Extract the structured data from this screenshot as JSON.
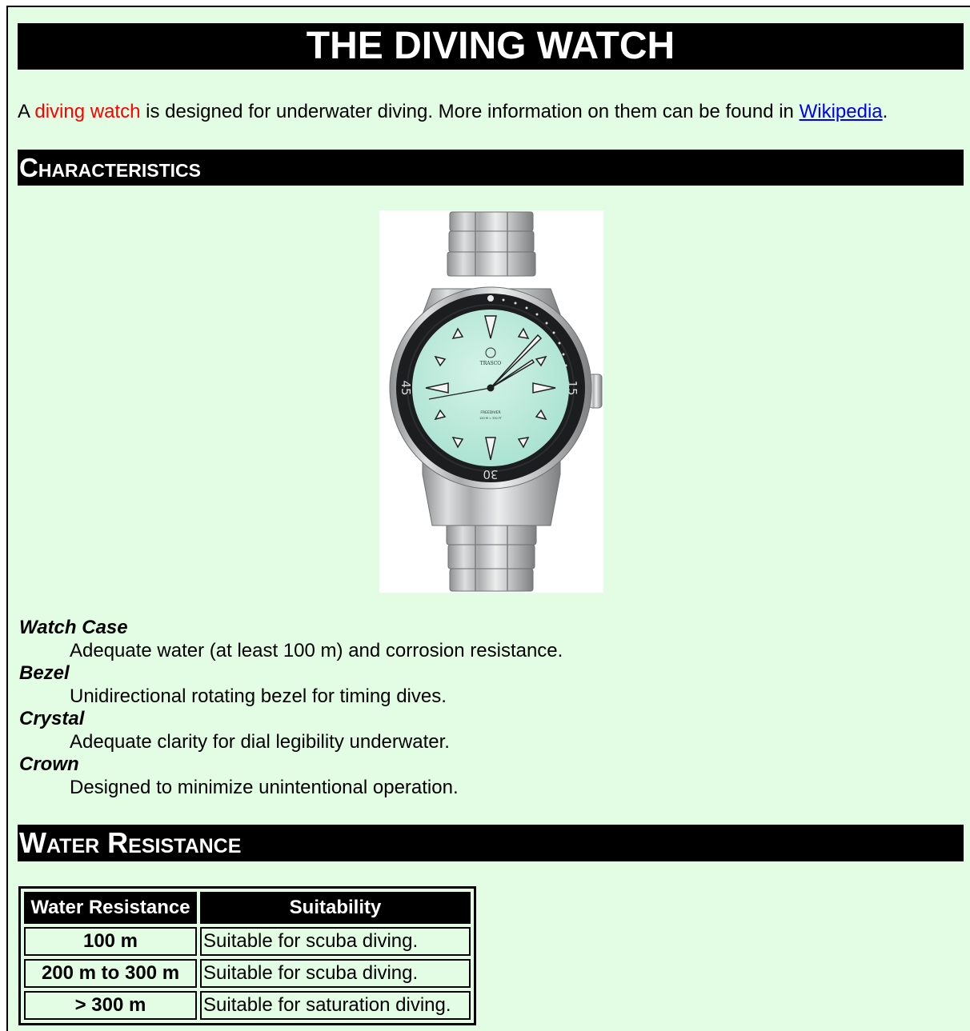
{
  "page": {
    "title": "THE DIVING WATCH",
    "intro": {
      "prefix": "A ",
      "highlight": "diving watch",
      "middle": " is designed for underwater diving. More information on them can be found in ",
      "link": "Wikipedia",
      "suffix": "."
    },
    "sections": {
      "characteristics": "Characteristics",
      "water_resistance": "Water Resistance"
    },
    "watch_image": {
      "bezel_labels": [
        "15",
        "30",
        "45"
      ],
      "brand": "TRASCO",
      "model": "FREEDIVER",
      "depth_text": "120 M = 330 FT"
    },
    "characteristics": [
      {
        "term": "Watch Case",
        "desc": "Adequate water (at least 100 m) and corrosion resistance."
      },
      {
        "term": "Bezel",
        "desc": "Unidirectional rotating bezel for timing dives."
      },
      {
        "term": "Crystal",
        "desc": "Adequate clarity for dial legibility underwater."
      },
      {
        "term": "Crown",
        "desc": "Designed to minimize unintentional operation."
      }
    ],
    "table": {
      "headers": [
        "Water Resistance",
        "Suitability"
      ],
      "rows": [
        {
          "resistance": "100 m",
          "suitability": "Suitable for scuba diving."
        },
        {
          "resistance": "200 m to 300 m",
          "suitability": "Suitable for scuba diving."
        },
        {
          "resistance": "> 300 m",
          "suitability": "Suitable for saturation diving."
        }
      ]
    }
  }
}
